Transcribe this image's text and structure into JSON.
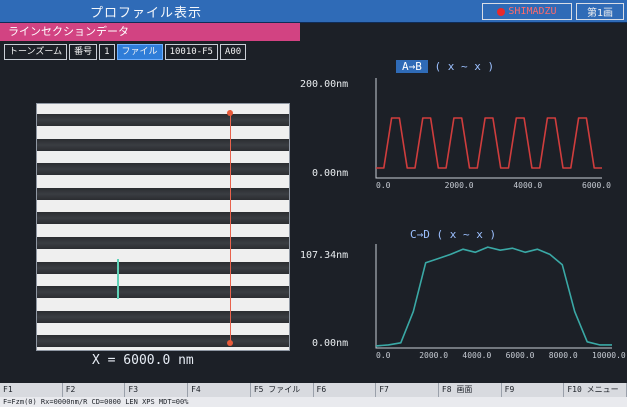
{
  "window": {
    "title": "プロファイル表示",
    "brand": "SHIMADZU",
    "corner": "第1画"
  },
  "mode_bar": {
    "label": "ラインセクションデータ"
  },
  "params": [
    {
      "label": "トーンズーム",
      "active": false
    },
    {
      "label": "番号",
      "active": false
    },
    {
      "label": "1",
      "active": false
    },
    {
      "label": "ファイル",
      "active": true
    },
    {
      "label": "10010-F5",
      "active": false
    },
    {
      "label": "A00",
      "active": false
    }
  ],
  "image": {
    "x_readout": "X = 6000.0 nm"
  },
  "colors": {
    "title_bar": "#2f6bb7",
    "mode_bar": "#d24382",
    "profile_ab": "#d03d3d",
    "profile_cd": "#3aa9a6"
  },
  "chart_data": [
    {
      "type": "line",
      "title": "A→B",
      "title_suffix": "( x ~ x )",
      "ylim_label_top": "200.00nm",
      "ylim_label_bottom": "0.00nm",
      "xticks": [
        "0.0",
        "2000.0",
        "4000.0",
        "6000.0"
      ],
      "series": [
        {
          "values": [
            0.1,
            0.1,
            0.6,
            0.6,
            0.1,
            0.1,
            0.6,
            0.6,
            0.1,
            0.1,
            0.6,
            0.6,
            0.1,
            0.1,
            0.6,
            0.6,
            0.1,
            0.1,
            0.6,
            0.6,
            0.1,
            0.1,
            0.6,
            0.6,
            0.1,
            0.1,
            0.6,
            0.6,
            0.1,
            0.1
          ]
        }
      ]
    },
    {
      "type": "line",
      "title": "C→D",
      "title_suffix": "( x ~ x )",
      "ylim_label_top": "107.34nm",
      "ylim_label_bottom": "0.00nm",
      "xticks": [
        "0.0",
        "2000.0",
        "4000.0",
        "6000.0",
        "8000.0",
        "10000.0"
      ],
      "series": [
        {
          "values": [
            0.02,
            0.03,
            0.05,
            0.35,
            0.82,
            0.86,
            0.9,
            0.95,
            0.92,
            0.97,
            0.94,
            0.96,
            0.92,
            0.95,
            0.9,
            0.8,
            0.35,
            0.06,
            0.03,
            0.03
          ]
        }
      ]
    }
  ],
  "function_keys": [
    "F1",
    "F2",
    "F3",
    "F4",
    "F5 ファイル",
    "F6",
    "F7",
    "F8 画面",
    "F9",
    "F10 メニュー"
  ],
  "status": "F=Fzm(0)  Rx=0000nm/R  CD=0000  LEN  XPS  MDT=00%"
}
